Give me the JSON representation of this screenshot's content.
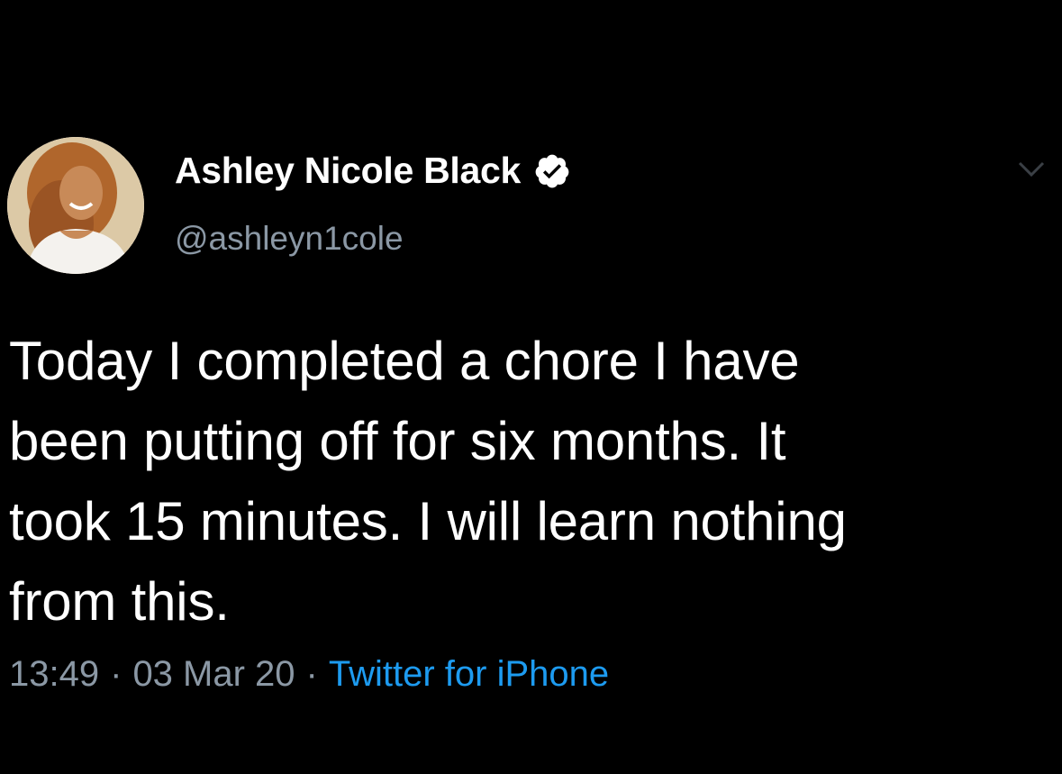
{
  "tweet": {
    "author": {
      "display_name": "Ashley Nicole Black",
      "handle": "@ashleyn1cole",
      "verified": true,
      "avatar_icon": "profile-photo"
    },
    "text": "Today I completed a chore I have\nbeen putting off for six months. It\ntook 15 minutes. I will learn nothing\nfrom this.",
    "time": "13:49",
    "date": "03 Mar 20",
    "separator": "·",
    "source": "Twitter for iPhone",
    "menu_icon": "chevron-down-icon"
  },
  "colors": {
    "background": "#000000",
    "text": "#ffffff",
    "muted": "#8b98a5",
    "accent": "#1d9bf0"
  }
}
